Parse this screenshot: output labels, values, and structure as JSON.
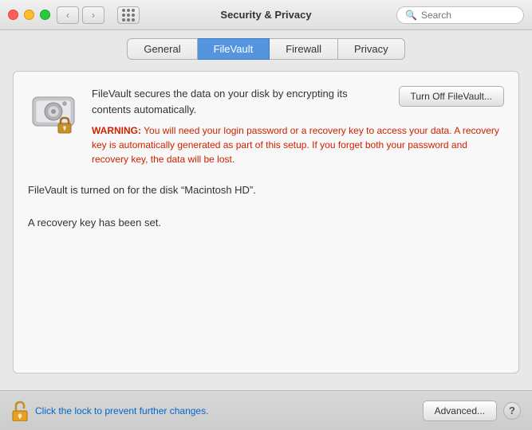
{
  "titlebar": {
    "title": "Security & Privacy",
    "search_placeholder": "Search"
  },
  "tabs": {
    "items": [
      {
        "id": "general",
        "label": "General",
        "active": false
      },
      {
        "id": "filevault",
        "label": "FileVault",
        "active": true
      },
      {
        "id": "firewall",
        "label": "Firewall",
        "active": false
      },
      {
        "id": "privacy",
        "label": "Privacy",
        "active": false
      }
    ]
  },
  "filevault": {
    "description": "FileVault secures the data on your disk by encrypting its contents automatically.",
    "warning_label": "WARNING:",
    "warning_text": " You will need your login password or a recovery key to access your data. A recovery key is automatically generated as part of this setup. If you forget both your password and recovery key, the data will be lost.",
    "status_line1": "FileVault is turned on for the disk “Macintosh HD”.",
    "status_line2": "A recovery key has been set.",
    "turn_off_label": "Turn Off FileVault..."
  },
  "bottom": {
    "lock_text": "Click the lock to prevent further changes.",
    "advanced_label": "Advanced...",
    "help_label": "?"
  }
}
